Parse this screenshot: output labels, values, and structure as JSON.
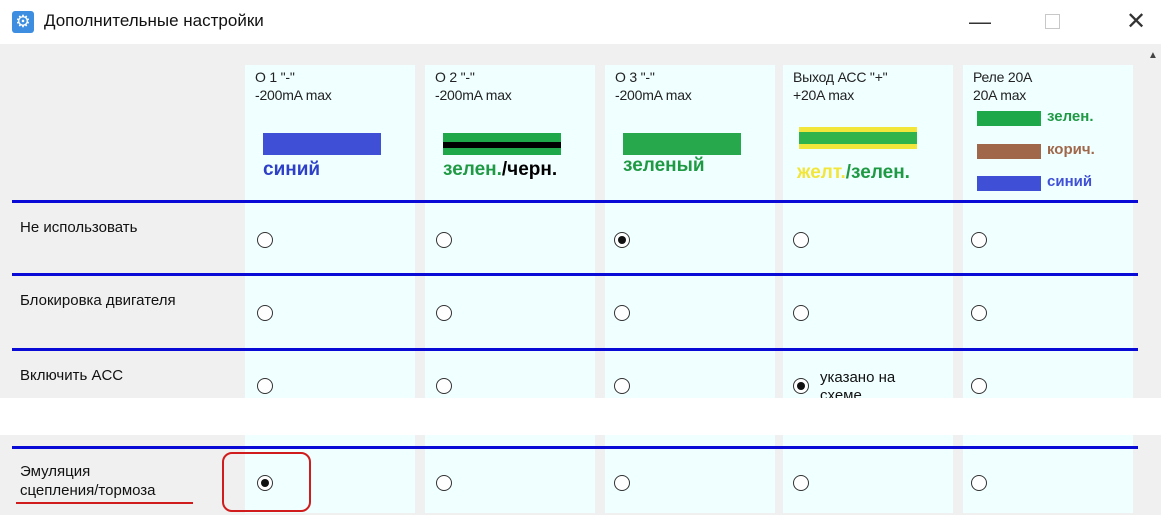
{
  "window": {
    "title": "Дополнительные настройки",
    "icon": "gear-icon",
    "minimize_glyph": "—",
    "close_glyph": "✕"
  },
  "columns": [
    {
      "title_line1": "О 1 \"-\"",
      "title_line2": "-200mA max",
      "color_label": "синий",
      "label_color": "#2e3fc8",
      "swatch": "blue"
    },
    {
      "title_line1": "О 2 \"-\"",
      "title_line2": "-200mA max",
      "color_label_part1": "зелен.",
      "color_label_part2": "/черн.",
      "label_color": "#1f9a44",
      "label_color2": "#000000",
      "swatch": "green-black"
    },
    {
      "title_line1": "О 3 \"-\"",
      "title_line2": "-200mA max",
      "color_label": "зеленый",
      "label_color": "#1f9a44",
      "swatch": "green"
    },
    {
      "title_line1": "Выход АСС \"+\"",
      "title_line2": "+20A max",
      "color_label_part1": "желт.",
      "color_label_part2": "/зелен.",
      "label_color": "#f2e63a",
      "label_color2": "#1f9a44",
      "swatch": "yellow-green"
    },
    {
      "title_line1": "Реле 20А",
      "title_line2": "20A max",
      "wires": [
        {
          "label": "зелен.",
          "color": "#1f9a44"
        },
        {
          "label": "корич.",
          "color": "#a0674a"
        },
        {
          "label": "синий",
          "color": "#3f4fd6"
        }
      ]
    }
  ],
  "rows": [
    {
      "label": "Не использовать",
      "selected": 2
    },
    {
      "label": "Блокировка двигателя",
      "selected": -1
    },
    {
      "label": "Включить ACC",
      "selected": 3,
      "note": "указано на",
      "note_clip": "схеме"
    },
    {
      "label_line1": "Эмуляция",
      "label_line2": "сцепления/тормоза",
      "selected": 0
    }
  ],
  "colors": {
    "separator": "#0a0ad6",
    "highlight": "#d01c1c",
    "column_bg": "#f0ffff"
  }
}
